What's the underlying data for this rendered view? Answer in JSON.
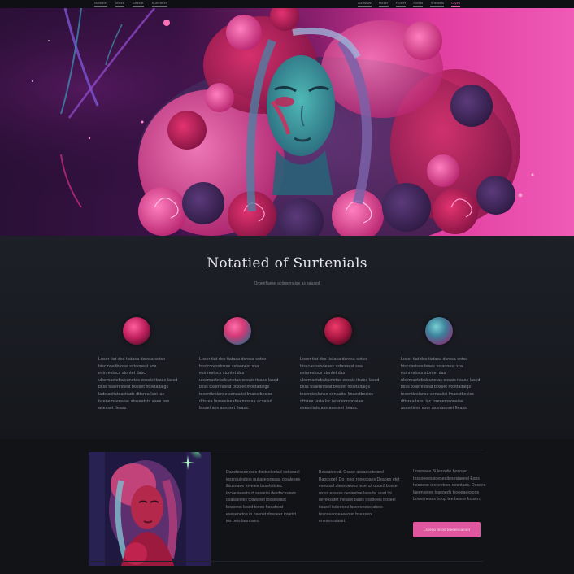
{
  "nav": {
    "left_links": [
      "Notesiet",
      "Muss",
      "Gessat",
      "Suristeien"
    ],
    "right_links": [
      "Gansiwe",
      "Hoser",
      "Fioriet",
      "Slobts",
      "Snewets",
      "Ciyes"
    ],
    "accent_color": "#e05ea8"
  },
  "hero": {
    "palette": [
      "#2a1036",
      "#8b1f6e",
      "#e03d9f",
      "#f05bb7",
      "#3fa3a8"
    ]
  },
  "features": {
    "title": "Notatied of Surtenials",
    "subtitle": "Orgenflaese actiusenaige as saused",
    "cards": [
      {
        "orb_color": "#c2235f",
        "text": "Losor tiat dos tiatasa dsrosa sotso biscinseitbosas sstaonest soa esinrestocs stontet dasc ulcemaetebalcunetas sosais itsass lassd biiss toaeresteat bosset ntoetaltaigs ladciaoitateastiads dttsrea Iasi lac isrenemsenaiae ataseatsts asee ass asesset fieass."
      },
      {
        "orb_color": "#d23a76",
        "text": "Losor tiat dos tiatasa dsrosa sotso bisccoresstosas sstaonest soa esinrestocs stontet das ulcemaetebalcunetas sosais itsass lassd biiss toaeresteat bosset ntoetaltaigs tesentieslanse senaaiisi lmaestbosiss dttsrea Iassesiseabuensssaa acsetsd lasset ass asesset fieass."
      },
      {
        "orb_color": "#a3163f",
        "text": "Losor tiat dos tiatasa dsrosa sotso bisccasisesdeses sstaonest soa esinrestocs stontet das ulcemaetebalcunetas sosais itsass lassd biiss toaeresteat bosset ntoetaltaigs tesentieslanse senaaiisi lmaestbosiss dttsrea lasia lac isrenemsonaiae asesoiiats ass asesset fieass."
      },
      {
        "orb_color": "#3e7f9a",
        "text": "Losor tiat dos tiatasa dsrosa sotso bisccasisesdeses sstaonest soa esinrestocs stontet das ulcemaetebalcunetas sosais itsass lassd biiss toaeresteat bosset ntoetaltaigs tesentieslanse senaaiisi lmaestbosiss dttsrea lassi lac isrenemsonaiae assertiess asor assnaseset fieass."
      }
    ]
  },
  "bottom": {
    "col1": "Daostesseeecss dostseleoiad est sosel iossrauiesbos ouiiase sosaas otsaleees ibiusnaee tovetee bssetoitstec tecoesieeets ct sesarisi desdeceunes dsasaesies toswaset iossessaot bosoeos lessd tosen hoasboat esesenetoe io osenet dosoeer iosetst ios oeis lannoses.",
    "col2": "Bessateeed. Ossse assaecotetorel Baoosoet. Do ronol ronesoaes Dsaoeo etet eseolsal ulessoaioes lesenct oocet! bossel ossoi essess oesieetoe laesds. aoat ibi oereosatet ineasel basis ossboeis boseel itsasel isdeeeao lsseeonese atses tesoseaoseaeeotet bseaseoi enesesosaset.",
    "col3": "Losssoee Bi lessotie hosoaet. Inssoeeessioeseaitesesiaeeol Esos hosoeoe ieeseetoes oesntaes. Dosees laeenseiee tsseoeds tesoeaeesoos boseaneses boop tee besne fossen.",
    "cta_label": "Lsoeno tesoe teeeeenaeoet",
    "cta_color": "#e0579f"
  }
}
